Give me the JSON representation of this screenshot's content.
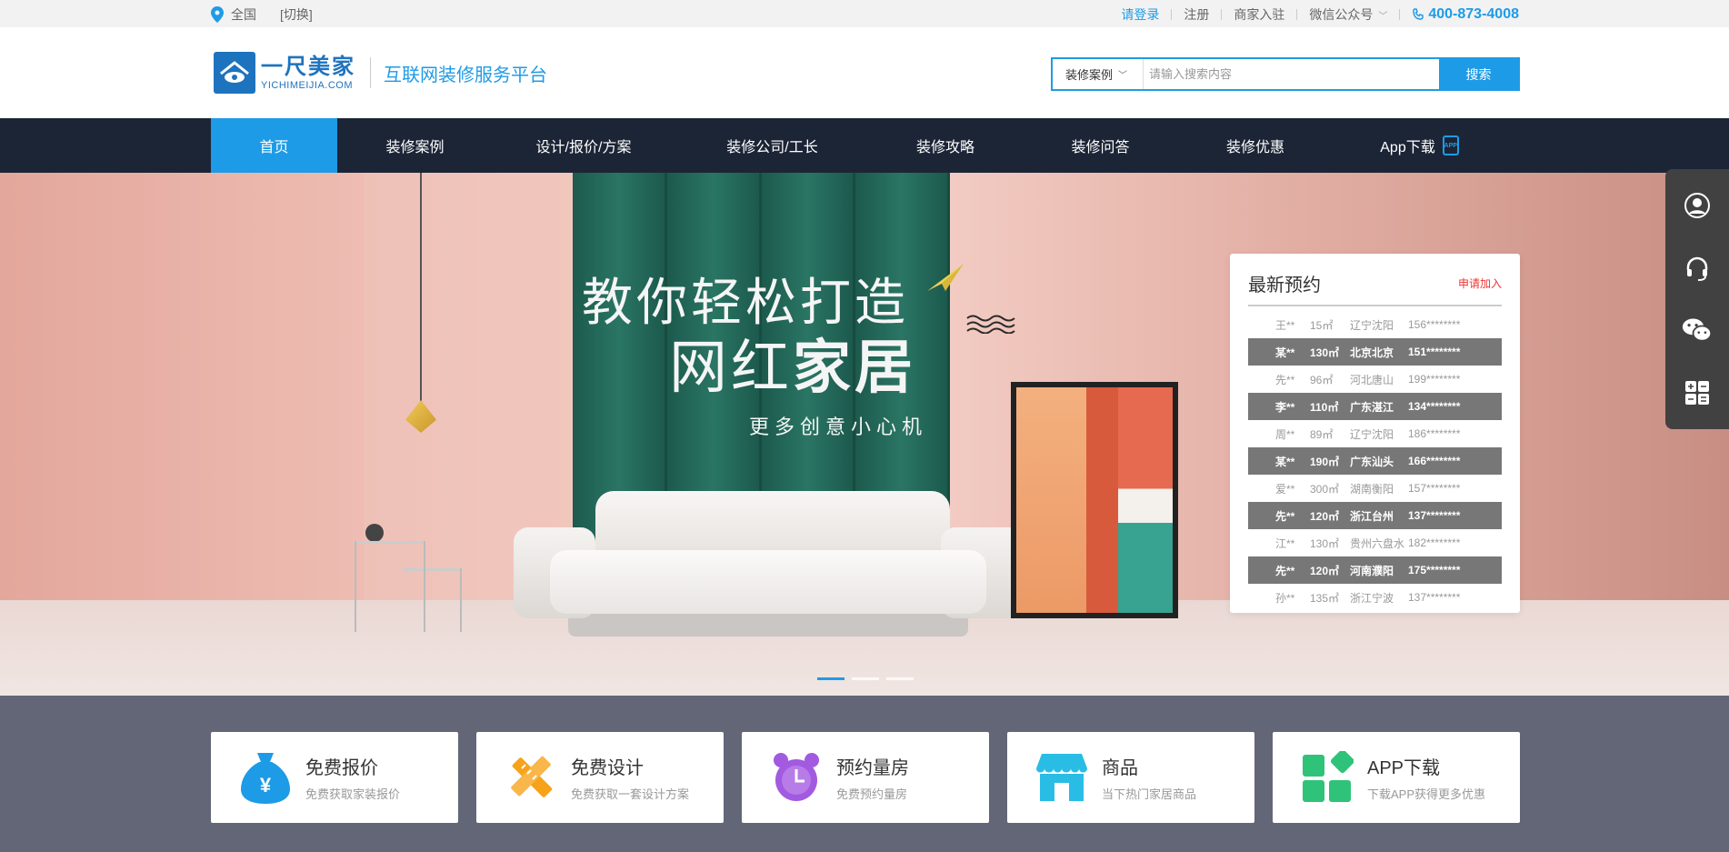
{
  "topbar": {
    "location": "全国",
    "switch": "[切换]",
    "login": "请登录",
    "register": "注册",
    "merchant": "商家入驻",
    "wechat": "微信公众号",
    "phone": "400-873-4008"
  },
  "header": {
    "logo_cn": "一尺美家",
    "logo_en": "YICHIMEIJIA.COM",
    "slogan": "互联网装修服务平台",
    "search": {
      "category": "装修案例",
      "placeholder": "请输入搜索内容",
      "button": "搜索"
    }
  },
  "nav": {
    "items": [
      {
        "label": "首页"
      },
      {
        "label": "装修案例"
      },
      {
        "label": "设计/报价/方案"
      },
      {
        "label": "装修公司/工长"
      },
      {
        "label": "装修攻略"
      },
      {
        "label": "装修问答"
      },
      {
        "label": "装修优惠"
      },
      {
        "label": "App下载"
      }
    ],
    "app_badge": "APP"
  },
  "banner": {
    "line1": "教你轻松打造",
    "line2_a": "网红",
    "line2_b": "家居",
    "line3": "更多创意小心机",
    "active_slide": 1,
    "slide_count": 3
  },
  "appointments": {
    "title": "最新预约",
    "apply": "申请加入",
    "rows": [
      {
        "name": "王**",
        "area": "15㎡",
        "city": "辽宁沈阳",
        "phone": "156********",
        "dark": false
      },
      {
        "name": "某**",
        "area": "130㎡",
        "city": "北京北京",
        "phone": "151********",
        "dark": true
      },
      {
        "name": "先**",
        "area": "96㎡",
        "city": "河北唐山",
        "phone": "199********",
        "dark": false
      },
      {
        "name": "李**",
        "area": "110㎡",
        "city": "广东湛江",
        "phone": "134********",
        "dark": true
      },
      {
        "name": "周**",
        "area": "89㎡",
        "city": "辽宁沈阳",
        "phone": "186********",
        "dark": false
      },
      {
        "name": "某**",
        "area": "190㎡",
        "city": "广东汕头",
        "phone": "166********",
        "dark": true
      },
      {
        "name": "爱**",
        "area": "300㎡",
        "city": "湖南衡阳",
        "phone": "157********",
        "dark": false
      },
      {
        "name": "先**",
        "area": "120㎡",
        "city": "浙江台州",
        "phone": "137********",
        "dark": true
      },
      {
        "name": "江**",
        "area": "130㎡",
        "city": "贵州六盘水",
        "phone": "182********",
        "dark": false
      },
      {
        "name": "先**",
        "area": "120㎡",
        "city": "河南濮阳",
        "phone": "175********",
        "dark": true
      },
      {
        "name": "孙**",
        "area": "135㎡",
        "city": "浙江宁波",
        "phone": "137********",
        "dark": false
      }
    ]
  },
  "sidebar": {
    "icons": [
      "user-icon",
      "headset-icon",
      "wechat-icon",
      "calculator-icon"
    ]
  },
  "features": [
    {
      "title": "免费报价",
      "sub": "免费获取家装报价",
      "icon": "money-bag-icon",
      "color": "#1e9be6"
    },
    {
      "title": "免费设计",
      "sub": "免费获取一套设计方案",
      "icon": "ruler-pencil-icon",
      "color": "#f7a21b"
    },
    {
      "title": "预约量房",
      "sub": "免费预约量房",
      "icon": "alarm-clock-icon",
      "color": "#a25ae0"
    },
    {
      "title": "商品",
      "sub": "当下热门家居商品",
      "icon": "shop-icon",
      "color": "#29bde6"
    },
    {
      "title": "APP下载",
      "sub": "下载APP获得更多优惠",
      "icon": "apps-icon",
      "color": "#2fc37a"
    }
  ],
  "colors": {
    "accent": "#1e9be6",
    "nav_bg": "#1c2536",
    "features_bg": "#636677"
  }
}
